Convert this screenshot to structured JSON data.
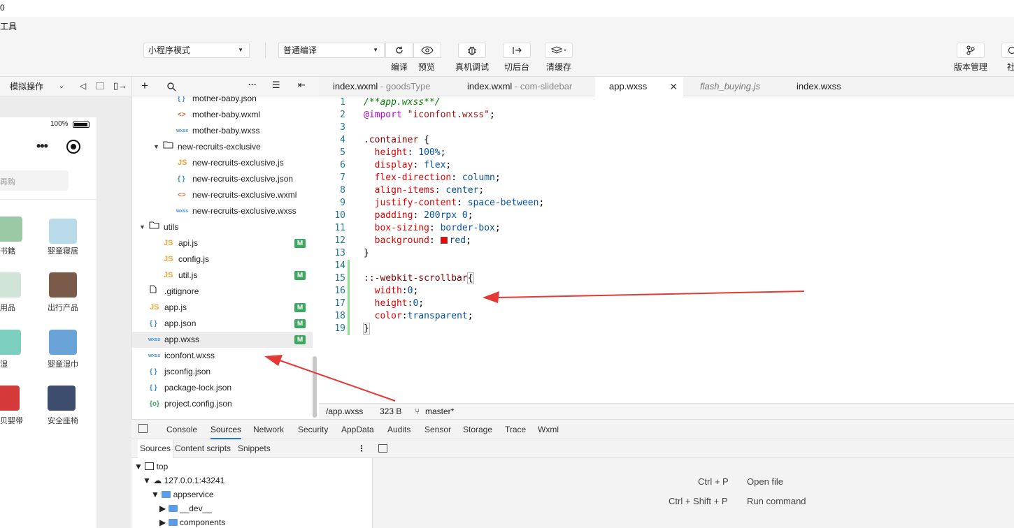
{
  "title_fragment": "0",
  "menu_fragment": "工具",
  "toolbar": {
    "mode_select": "小程序模式",
    "compile_select": "普通编译",
    "compile_label": "编译",
    "preview_label": "预览",
    "debug_label": "真机调试",
    "background_label": "切后台",
    "cache_label": "清缓存",
    "version_label": "版本管理",
    "community_label": "社"
  },
  "simulator": {
    "operation_select": "模拟操作",
    "battery": "100%",
    "search_placeholder": "再购",
    "categories": [
      {
        "label": "书籍",
        "color": "#9bc9a6"
      },
      {
        "label": "婴童寝居",
        "color": "#b9dbe9"
      },
      {
        "label": "用品",
        "color": "#cfe3d6"
      },
      {
        "label": "出行产品",
        "color": "#7a5a48"
      },
      {
        "label": "湿",
        "color": "#7ccfbf"
      },
      {
        "label": "婴童湿巾",
        "color": "#6aa3d8"
      },
      {
        "label": "贝婴带",
        "color": "#d43a3a"
      },
      {
        "label": "安全座椅",
        "color": "#3d4d6e"
      }
    ]
  },
  "file_tree": [
    {
      "name": "mother-baby.json",
      "type": "json",
      "indent": 2,
      "badge": ""
    },
    {
      "name": "mother-baby.wxml",
      "type": "wxml",
      "indent": 2,
      "badge": ""
    },
    {
      "name": "mother-baby.wxss",
      "type": "wxss",
      "indent": 2,
      "badge": ""
    },
    {
      "name": "new-recruits-exclusive",
      "type": "folder",
      "indent": 1,
      "badge": ""
    },
    {
      "name": "new-recruits-exclusive.js",
      "type": "js",
      "indent": 2,
      "badge": ""
    },
    {
      "name": "new-recruits-exclusive.json",
      "type": "json",
      "indent": 2,
      "badge": ""
    },
    {
      "name": "new-recruits-exclusive.wxml",
      "type": "wxml",
      "indent": 2,
      "badge": ""
    },
    {
      "name": "new-recruits-exclusive.wxss",
      "type": "wxss",
      "indent": 2,
      "badge": ""
    },
    {
      "name": "utils",
      "type": "folder",
      "indent": 0,
      "badge": ""
    },
    {
      "name": "api.js",
      "type": "js",
      "indent": 1,
      "badge": "M"
    },
    {
      "name": "config.js",
      "type": "js",
      "indent": 1,
      "badge": ""
    },
    {
      "name": "util.js",
      "type": "js",
      "indent": 1,
      "badge": "M"
    },
    {
      "name": ".gitignore",
      "type": "file",
      "indent": 0,
      "badge": ""
    },
    {
      "name": "app.js",
      "type": "js",
      "indent": 0,
      "badge": "M"
    },
    {
      "name": "app.json",
      "type": "json",
      "indent": 0,
      "badge": "M"
    },
    {
      "name": "app.wxss",
      "type": "wxss",
      "indent": 0,
      "badge": "M"
    },
    {
      "name": "iconfont.wxss",
      "type": "wxss",
      "indent": 0,
      "badge": ""
    },
    {
      "name": "jsconfig.json",
      "type": "json",
      "indent": 0,
      "badge": ""
    },
    {
      "name": "package-lock.json",
      "type": "json",
      "indent": 0,
      "badge": ""
    },
    {
      "name": "project.config.json",
      "type": "jsonp",
      "indent": 0,
      "badge": ""
    }
  ],
  "selected_file": "app.wxss",
  "tabs": [
    {
      "name": "index.wxml",
      "suffix": " - goodsType"
    },
    {
      "name": "index.wxml",
      "suffix": " - com-slidebar"
    },
    {
      "name": "app.wxss",
      "suffix": ""
    },
    {
      "name": "flash_buying.js",
      "suffix": ""
    },
    {
      "name": "index.wxss",
      "suffix": ""
    }
  ],
  "active_tab": "app.wxss",
  "code_lines": [
    "/**app.wxss**/",
    "@import \"iconfont.wxss\";",
    "",
    ".container {",
    "  height: 100%;",
    "  display: flex;",
    "  flex-direction: column;",
    "  align-items: center;",
    "  justify-content: space-between;",
    "  padding: 200rpx 0;",
    "  box-sizing: border-box;",
    "  background: red;",
    "}",
    "",
    "::-webkit-scrollbar{",
    "  width:0;",
    "  height:0;",
    "  color:transparent;",
    "}"
  ],
  "status": {
    "path": "/app.wxss",
    "size": "323 B",
    "branch": "master*"
  },
  "devtools": {
    "tabs": [
      "Console",
      "Sources",
      "Network",
      "Security",
      "AppData",
      "Audits",
      "Sensor",
      "Storage",
      "Trace",
      "Wxml"
    ],
    "active_tab": "Sources",
    "subtabs": [
      "Sources",
      "Content scripts",
      "Snippets"
    ],
    "tree": {
      "top": "top",
      "host": "127.0.0.1:43241",
      "appservice": "appservice",
      "dev": "__dev__",
      "components": "components"
    },
    "shortcuts": [
      {
        "keys": "Ctrl + P",
        "action": "Open file"
      },
      {
        "keys": "Ctrl + Shift + P",
        "action": "Run command"
      }
    ]
  },
  "colors": {
    "modified_badge": "#3ea860",
    "arrow": "#e53935",
    "swatch_red": "#ff0000"
  }
}
